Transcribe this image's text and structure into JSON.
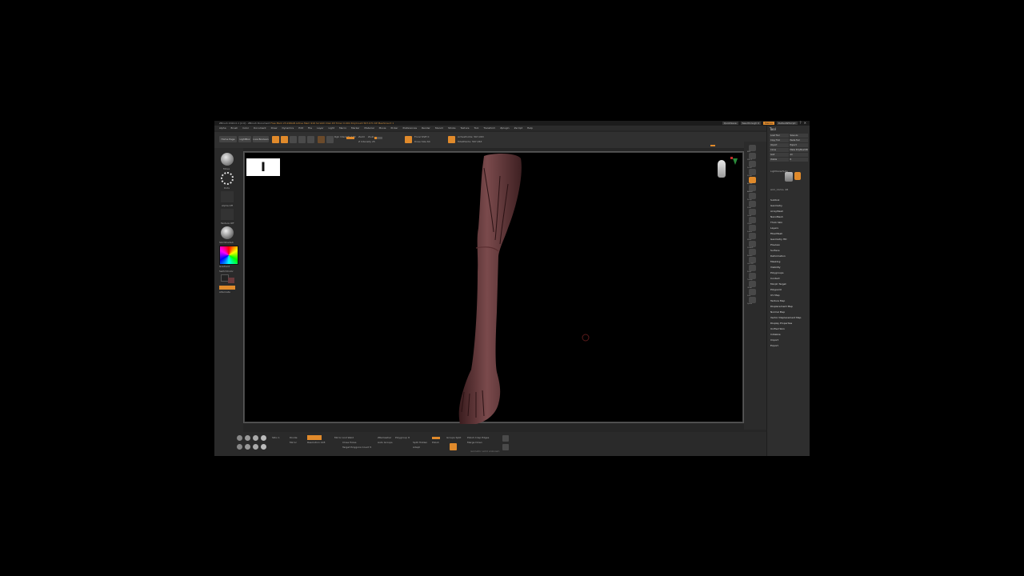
{
  "app": {
    "title": "ZBrush 2024.0.1 [2.0] - ZBrush Document",
    "title_extra": "Free Mem 23.246GB  Active Mem 916  Scratch Disk 48  Timer 0.001  PolyCount 567.071 KP  MeshCount 1",
    "quicksave": "QuickSave",
    "see_through": "See-through 0",
    "menus_label": "Menus",
    "default_script": "DefaultZScript"
  },
  "menubar": [
    "Alpha",
    "Brush",
    "Color",
    "Document",
    "Draw",
    "Dynamics",
    "Edit",
    "File",
    "Layer",
    "Light",
    "Macro",
    "Marker",
    "Material",
    "Movie",
    "Picker",
    "Preferences",
    "Render",
    "Stencil",
    "Stroke",
    "Texture",
    "Tool",
    "Transform",
    "Zplugin",
    "Zscript",
    "Help"
  ],
  "shelf": {
    "home_page": "Home Page",
    "lightbox": "LightBox",
    "live_boolean": "Live Boolean",
    "edit": "Edit",
    "draw": "Draw",
    "move": "Move",
    "scale": "Scale",
    "rotate": "Rotate",
    "mrgb": "Mrgb",
    "rgb": "Rgb",
    "m": "M",
    "zadd": "Zadd",
    "zsub": "Zsub",
    "zcut": "Zcut",
    "rgb_intensity": "Rgb Intensity 100",
    "z_intensity": "Z Intensity 25",
    "focal_shift": "Focal Shift 0",
    "draw_size": "Draw Size 64",
    "dynamic": "Dynamic",
    "active_points": "ActivePoints: 567,063",
    "total_points": "TotalPoints: 567,063"
  },
  "left_tray": {
    "brush_label": "Move",
    "stroke_label": "Dots",
    "alpha_label": "Alpha Off",
    "texture_label": "Texture Off",
    "material_label": "SkinShade4",
    "gradient_label": "Gradient",
    "switch_color": "SwitchColor",
    "alternate": "Alternate"
  },
  "viewport": {
    "thumbnail_glyph": "I"
  },
  "right_tray": {
    "items": [
      "BPR",
      "SPix 3",
      "Scroll",
      "Zoom",
      "Actual",
      "AAHalf",
      "Persp",
      "Floor",
      "Local",
      "LSym",
      "Frame",
      "Move",
      "ZoomD",
      "Rotate",
      "Line Fill",
      "PolyF",
      "Transp",
      "Ghost",
      "Solo",
      "Xpose"
    ]
  },
  "tool_panel": {
    "title": "Tool",
    "buttons": [
      "Load Tool",
      "Save As",
      "Copy Tool",
      "Paste Tool",
      "Import",
      "Export",
      "Clone",
      "Make PolyMesh3D",
      "GoZ",
      "All",
      "Visible",
      "R"
    ],
    "lightbox_tools": "Lightbox▸Tools",
    "current": "Arm_Uomo. 48",
    "sections": [
      "Subtool",
      "Geometry",
      "ArrayMesh",
      "NanoMesh",
      "Thick Skin",
      "Layers",
      "FiberMesh",
      "Geometry HD",
      "Preview",
      "Surface",
      "Deformation",
      "Masking",
      "Visibility",
      "Polygroups",
      "Contact",
      "Morph Target",
      "Polypaint",
      "UV Map",
      "Texture Map",
      "Displacement Map",
      "Normal Map",
      "Vector Displacement Map",
      "Display Properties",
      "Unified Skin",
      "Initialize",
      "Import",
      "Export"
    ]
  },
  "bottom_tray": {
    "sym": "Sym",
    "mirror": "Mirror",
    "mirror_weld": "Mirror And Weld",
    "close_holes": "Close Holes",
    "polish": "Polish",
    "smooth": "Smooth",
    "dynamesh": "DynaMesh",
    "resolution": "Resolution 128",
    "zremesher": "ZRemesher",
    "target_polygons": "Target Polygons Count 5",
    "adapt": "Adapt",
    "half": "Half",
    "same": "Same",
    "double": "Double",
    "divide": "Divide",
    "sdiv": "SDiv 1",
    "del_lower": "Del Lower",
    "del_higher": "Del Higher",
    "reconstruct": "Reconstruct Subdiv",
    "split_hidden": "Split Hidden",
    "group_split": "Groups Split",
    "merge_down": "Merge Down",
    "polygroup_it": "Polygroup It",
    "auto_groups": "Auto Groups",
    "backface_mask": "BackfaceMask",
    "polish_crisp": "Polish Crisp Edges",
    "note": "isometric solid unknown"
  },
  "colors": {
    "accent": "#e08a2b",
    "viewport_bg": "#000000",
    "ui_bg": "#262626",
    "mesh": "#6a3a3c"
  }
}
